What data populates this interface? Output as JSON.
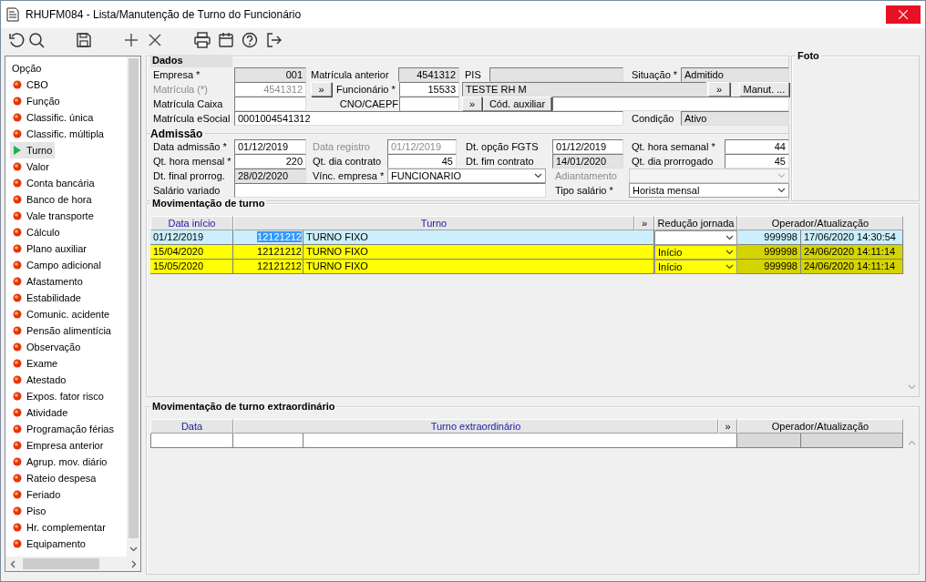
{
  "window": {
    "title": "RHUFM084 - Lista/Manutenção de Turno do Funcionário"
  },
  "toolbar": [
    {
      "kind": "refresh"
    },
    {
      "kind": "search"
    },
    {
      "kind": "save"
    },
    {
      "kind": "add"
    },
    {
      "kind": "delete"
    },
    {
      "kind": "print"
    },
    {
      "kind": "calendar"
    },
    {
      "kind": "help"
    },
    {
      "kind": "exit"
    }
  ],
  "sidebar": {
    "title": "Opção",
    "items": [
      {
        "label": "CBO",
        "selected": false
      },
      {
        "label": "Função",
        "selected": false
      },
      {
        "label": "Classific. única",
        "selected": false
      },
      {
        "label": "Classific. múltipla",
        "selected": false
      },
      {
        "label": "Turno",
        "selected": true
      },
      {
        "label": "Valor",
        "selected": false
      },
      {
        "label": "Conta bancária",
        "selected": false
      },
      {
        "label": "Banco de hora",
        "selected": false
      },
      {
        "label": "Vale transporte",
        "selected": false
      },
      {
        "label": "Cálculo",
        "selected": false
      },
      {
        "label": "Plano auxiliar",
        "selected": false
      },
      {
        "label": "Campo adicional",
        "selected": false
      },
      {
        "label": "Afastamento",
        "selected": false
      },
      {
        "label": "Estabilidade",
        "selected": false
      },
      {
        "label": "Comunic. acidente",
        "selected": false
      },
      {
        "label": "Pensão alimentícia",
        "selected": false
      },
      {
        "label": "Observação",
        "selected": false
      },
      {
        "label": "Exame",
        "selected": false
      },
      {
        "label": "Atestado",
        "selected": false
      },
      {
        "label": "Expos. fator risco",
        "selected": false
      },
      {
        "label": "Atividade",
        "selected": false
      },
      {
        "label": "Programação férias",
        "selected": false
      },
      {
        "label": "Empresa anterior",
        "selected": false
      },
      {
        "label": "Agrup. mov. diário",
        "selected": false
      },
      {
        "label": "Rateio despesa",
        "selected": false
      },
      {
        "label": "Feriado",
        "selected": false
      },
      {
        "label": "Piso",
        "selected": false
      },
      {
        "label": "Hr. complementar",
        "selected": false
      },
      {
        "label": "Equipamento",
        "selected": false
      }
    ]
  },
  "dados": {
    "title": "Dados",
    "section2": "Admissão",
    "lines": [
      {
        "items": [
          {
            "kind": "label",
            "text": "Empresa *"
          },
          {
            "kind": "field",
            "value": "001",
            "numeric": true,
            "readonly": true
          },
          {
            "kind": "label",
            "text": "Matrícula anterior"
          },
          {
            "kind": "field",
            "value": "4541312",
            "numeric": true,
            "readonly": true
          },
          {
            "kind": "label",
            "text": "PIS"
          },
          {
            "kind": "field",
            "readonly": true
          },
          {
            "kind": "label",
            "text": "Situação *"
          },
          {
            "kind": "field",
            "value": "Admitido",
            "readonly": true
          }
        ]
      },
      {
        "items": [
          {
            "kind": "label",
            "text": "Matrícula (*)",
            "disabled": true
          },
          {
            "kind": "field",
            "value": "4541312",
            "numeric": true,
            "disabled": true
          },
          {
            "kind": "button",
            "text": "»"
          },
          {
            "kind": "label",
            "text": "Funcionário *"
          },
          {
            "kind": "field",
            "value": "15533",
            "numeric": true
          },
          {
            "kind": "field",
            "value": "TESTE RH M",
            "readonly": true
          },
          {
            "kind": "button",
            "text": "»"
          },
          {
            "kind": "button",
            "text": "Manut. ..."
          }
        ]
      },
      {
        "items": [
          {
            "kind": "label",
            "text": "Matrícula Caixa"
          },
          {
            "kind": "field"
          },
          {
            "kind": "label",
            "text": "CNO/CAEPF",
            "right_aligned": true
          },
          {
            "kind": "field"
          },
          {
            "kind": "button",
            "text": "»"
          },
          {
            "kind": "button",
            "text": "Cód. auxiliar"
          },
          {
            "kind": "field"
          }
        ]
      },
      {
        "items": [
          {
            "kind": "label",
            "text": "Matrícula eSocial"
          },
          {
            "kind": "field",
            "value": "0001004541312"
          },
          {
            "kind": "label",
            "text": "Condição"
          },
          {
            "kind": "field",
            "value": "Ativo",
            "readonly": true
          }
        ]
      },
      {
        "items": [
          {
            "kind": "label",
            "text": "Data admissão *"
          },
          {
            "kind": "field",
            "value": "01/12/2019"
          },
          {
            "kind": "label",
            "text": "Data registro",
            "disabled": true
          },
          {
            "kind": "field",
            "value": "01/12/2019",
            "disabled": true
          },
          {
            "kind": "label",
            "text": "Dt. opção FGTS"
          },
          {
            "kind": "field",
            "value": "01/12/2019"
          },
          {
            "kind": "label",
            "text": "Qt. hora semanal *"
          },
          {
            "kind": "field",
            "value": "44",
            "numeric": true
          }
        ]
      },
      {
        "items": [
          {
            "kind": "label",
            "text": "Qt. hora mensal *"
          },
          {
            "kind": "field",
            "value": "220",
            "numeric": true
          },
          {
            "kind": "label",
            "text": "Qt. dia contrato"
          },
          {
            "kind": "field",
            "value": "45",
            "numeric": true
          },
          {
            "kind": "label",
            "text": "Dt. fim contrato"
          },
          {
            "kind": "field",
            "value": "14/01/2020",
            "readonly": true
          },
          {
            "kind": "label",
            "text": "Qt. dia prorrogado"
          },
          {
            "kind": "field",
            "value": "45",
            "numeric": true
          }
        ]
      },
      {
        "items": [
          {
            "kind": "label",
            "text": "Dt. final prorrog."
          },
          {
            "kind": "field",
            "value": "28/02/2020",
            "readonly": true
          },
          {
            "kind": "label",
            "text": "Vínc. empresa *"
          },
          {
            "kind": "select",
            "value": "FUNCIONARIO"
          },
          {
            "kind": "label",
            "text": "Adiantamento",
            "disabled": true
          },
          {
            "kind": "select",
            "disabled": true
          }
        ]
      },
      {
        "items": [
          {
            "kind": "label",
            "text": "Salário variado"
          },
          {
            "kind": "field"
          },
          {
            "kind": "label",
            "text": "Tipo salário *"
          },
          {
            "kind": "select",
            "value": "Horista mensal"
          }
        ]
      }
    ]
  },
  "foto": {
    "title": "Foto"
  },
  "turnos": {
    "title": "Movimentação de turno",
    "columns": [
      {
        "label": "Data início",
        "sortable": true
      },
      {
        "label": "Turno",
        "sortable": true
      },
      {
        "label": "»",
        "sortable": false
      },
      {
        "label": "Redução jornada",
        "sortable": false
      },
      {
        "label": "Operador/Atualização",
        "sortable": false
      }
    ],
    "rows": [
      {
        "date": "01/12/2019",
        "code": "12121212",
        "name": "TURNO FIXO",
        "operator": "999998",
        "updated": "17/06/2020 14:30:54",
        "selected": true
      },
      {
        "date": "15/04/2020",
        "code": "12121212",
        "name": "TURNO FIXO",
        "reduction": "Início",
        "operator": "999998",
        "updated": "24/06/2020 14:11:14",
        "selected": false,
        "color": "#ffff00"
      },
      {
        "date": "15/05/2020",
        "code": "12121212",
        "name": "TURNO FIXO",
        "reduction": "Início",
        "operator": "999998",
        "updated": "24/06/2020 14:11:14",
        "selected": false,
        "color": "#ffff00"
      }
    ]
  },
  "extra": {
    "title": "Movimentação de turno extraordinário",
    "columns": [
      {
        "label": "Data",
        "sortable": true
      },
      {
        "label": "Turno extraordinário",
        "sortable": true
      },
      {
        "label": "»",
        "sortable": false
      },
      {
        "label": "Operador/Atualização",
        "sortable": false
      }
    ]
  }
}
